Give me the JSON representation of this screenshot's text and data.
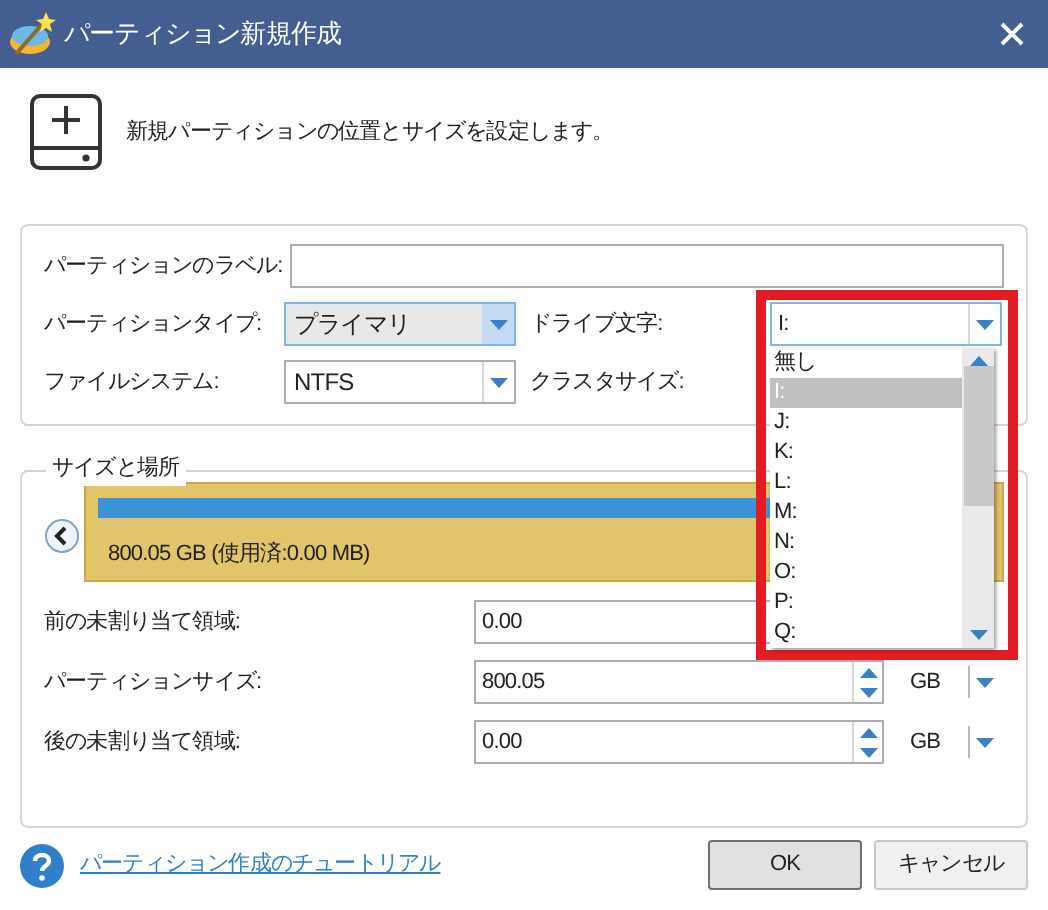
{
  "window": {
    "title": "パーティション新規作成"
  },
  "header": {
    "text": "新規パーティションの位置とサイズを設定します。"
  },
  "properties": {
    "label_field": {
      "label": "パーティションのラベル:"
    },
    "partition_type": {
      "label": "パーティションタイプ:",
      "value": "プライマリ",
      "focused": true
    },
    "drive_letter": {
      "label": "ドライブ文字:",
      "value": "I:",
      "expanded": true,
      "highlighted": true,
      "options": [
        {
          "text": "無し",
          "selected": false
        },
        {
          "text": "I:",
          "selected": true
        },
        {
          "text": "J:",
          "selected": false
        },
        {
          "text": "K:",
          "selected": false
        },
        {
          "text": "L:",
          "selected": false
        },
        {
          "text": "M:",
          "selected": false
        },
        {
          "text": "N:",
          "selected": false
        },
        {
          "text": "O:",
          "selected": false
        },
        {
          "text": "P:",
          "selected": false
        },
        {
          "text": "Q:",
          "selected": false
        }
      ]
    },
    "file_system": {
      "label": "ファイルシステム:",
      "value": "NTFS",
      "focused": false
    },
    "cluster_size": {
      "label": "クラスタサイズ:"
    }
  },
  "size_and_location": {
    "title": "サイズと場所",
    "disk": {
      "text": "800.05 GB (使用済:0.00 MB)"
    },
    "fields": [
      {
        "label": "前の未割り当て領域:",
        "value": "0.00"
      },
      {
        "label": "パーティションサイズ:",
        "value": "800.05",
        "unit": "GB"
      },
      {
        "label": "後の未割り当て領域:",
        "value": "0.00",
        "unit": "GB"
      }
    ]
  },
  "footer": {
    "link": "パーティション作成のチュートリアル",
    "buttons": [
      {
        "label": "OK",
        "kind": "default"
      },
      {
        "label": "キャンセル",
        "kind": "normal"
      }
    ]
  }
}
